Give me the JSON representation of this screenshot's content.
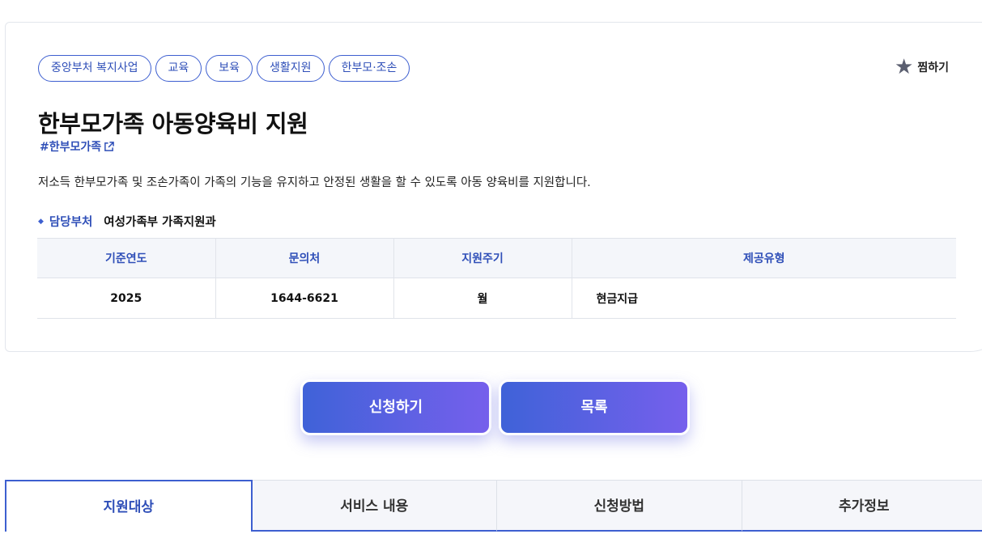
{
  "tags": [
    "중앙부처 복지사업",
    "교육",
    "보육",
    "생활지원",
    "한부모·조손"
  ],
  "favorite": {
    "label": "찜하기",
    "icon": "star-icon"
  },
  "title": "한부모가족 아동양육비 지원",
  "hashtag": "#한부모가족",
  "description": "저소득 한부모가족 및 조손가족이 가족의 기능을 유지하고 안정된 생활을 할 수 있도록 아동 양육비를 지원합니다.",
  "department": {
    "label": "담당부처",
    "value": "여성가족부 가족지원과"
  },
  "info_table": {
    "headers": [
      "기준연도",
      "문의처",
      "지원주기",
      "제공유형"
    ],
    "row": [
      "2025",
      "1644-6621",
      "월",
      "현금지급"
    ]
  },
  "buttons": {
    "apply": "신청하기",
    "list": "목록"
  },
  "tabs": [
    "지원대상",
    "서비스 내용",
    "신청방법",
    "추가정보"
  ],
  "active_tab": "지원대상",
  "colors": {
    "accent": "#3d5fd0",
    "gradient_start": "#3f62d8",
    "gradient_end": "#7660ec"
  }
}
